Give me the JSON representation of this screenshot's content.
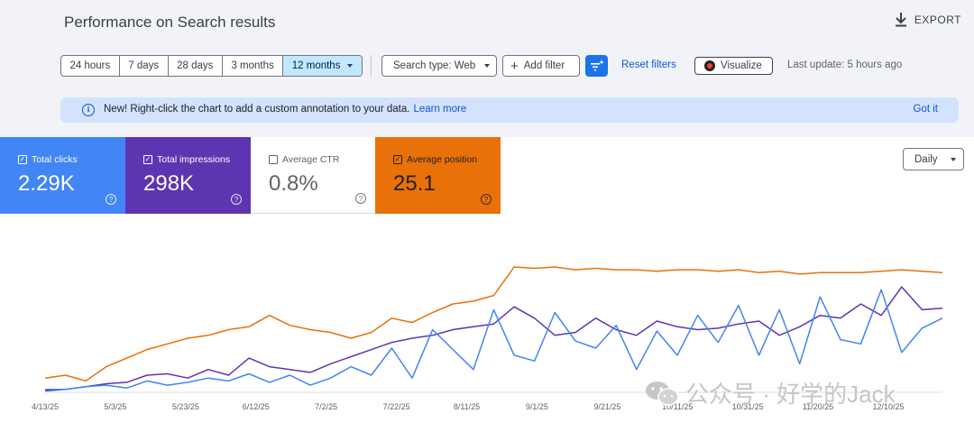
{
  "title": "Performance on Search results",
  "export_label": "EXPORT",
  "date_ranges": [
    {
      "label": "24 hours",
      "active": false
    },
    {
      "label": "7 days",
      "active": false
    },
    {
      "label": "28 days",
      "active": false
    },
    {
      "label": "3 months",
      "active": false
    },
    {
      "label": "12 months",
      "active": true
    }
  ],
  "search_type": "Search type: Web",
  "add_filter": "Add filter",
  "reset_filters": "Reset filters",
  "visualize": "Visualize",
  "last_update": "Last update: 5 hours ago",
  "banner": {
    "text": "New! Right-click the chart to add a custom annotation to your data.",
    "link": "Learn more",
    "dismiss": "Got it"
  },
  "metrics": [
    {
      "label": "Total clicks",
      "value": "2.29K",
      "checked": true,
      "color": "#4285f4"
    },
    {
      "label": "Total impressions",
      "value": "298K",
      "checked": true,
      "color": "#5e35b1"
    },
    {
      "label": "Average CTR",
      "value": "0.8%",
      "checked": false,
      "color": "#ffffff"
    },
    {
      "label": "Average position",
      "value": "25.1",
      "checked": true,
      "color": "#e8710a"
    }
  ],
  "granularity": "Daily",
  "chart_data": {
    "type": "line",
    "x_ticks": [
      "4/13/25",
      "5/3/25",
      "5/23/25",
      "6/12/25",
      "7/2/25",
      "7/22/25",
      "8/11/25",
      "9/1/25",
      "9/21/25",
      "10/11/25",
      "10/31/25",
      "11/20/25",
      "12/10/25"
    ],
    "series": [
      {
        "name": "Total clicks",
        "color": "#4285f4",
        "values": [
          0.02,
          0.02,
          0.04,
          0.05,
          0.03,
          0.08,
          0.05,
          0.07,
          0.1,
          0.08,
          0.13,
          0.07,
          0.12,
          0.05,
          0.1,
          0.18,
          0.12,
          0.31,
          0.1,
          0.44,
          0.3,
          0.16,
          0.58,
          0.26,
          0.22,
          0.56,
          0.36,
          0.31,
          0.47,
          0.16,
          0.43,
          0.26,
          0.54,
          0.35,
          0.61,
          0.26,
          0.58,
          0.2,
          0.67,
          0.37,
          0.34,
          0.72,
          0.28,
          0.45,
          0.52
        ]
      },
      {
        "name": "Total impressions",
        "color": "#5e35b1",
        "values": [
          0.01,
          0.02,
          0.04,
          0.06,
          0.07,
          0.12,
          0.13,
          0.1,
          0.16,
          0.12,
          0.24,
          0.18,
          0.16,
          0.14,
          0.2,
          0.25,
          0.3,
          0.35,
          0.38,
          0.4,
          0.44,
          0.46,
          0.48,
          0.6,
          0.52,
          0.4,
          0.42,
          0.52,
          0.44,
          0.4,
          0.5,
          0.46,
          0.44,
          0.45,
          0.48,
          0.5,
          0.4,
          0.46,
          0.54,
          0.52,
          0.62,
          0.54,
          0.74,
          0.58,
          0.59
        ]
      },
      {
        "name": "Average position",
        "color": "#e8710a",
        "values": [
          0.1,
          0.12,
          0.08,
          0.18,
          0.24,
          0.3,
          0.34,
          0.38,
          0.4,
          0.44,
          0.46,
          0.54,
          0.47,
          0.44,
          0.42,
          0.38,
          0.42,
          0.52,
          0.49,
          0.56,
          0.62,
          0.64,
          0.68,
          0.88,
          0.87,
          0.88,
          0.86,
          0.87,
          0.86,
          0.86,
          0.85,
          0.86,
          0.86,
          0.85,
          0.86,
          0.84,
          0.85,
          0.83,
          0.84,
          0.84,
          0.84,
          0.85,
          0.86,
          0.85,
          0.84
        ]
      }
    ]
  },
  "watermark": "公众号 · 好学的Jack"
}
